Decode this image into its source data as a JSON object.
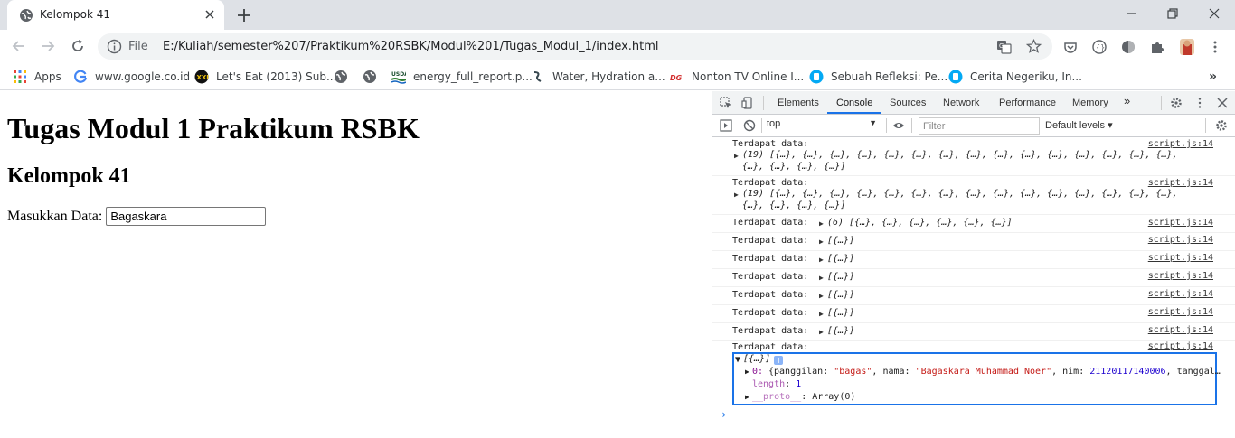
{
  "browser": {
    "tab_title": "Kelompok 41",
    "omnibox": {
      "security_label": "File",
      "url": "E:/Kuliah/semester%207/Praktikum%20RSBK/Modul%201/Tugas_Modul_1/index.html"
    },
    "bookmarks": [
      {
        "label": "Apps",
        "icon": "apps-grid-icon"
      },
      {
        "label": "www.google.co.id",
        "icon": "google-g-icon"
      },
      {
        "label": "Let's Eat (2013) Sub...",
        "icon": "movie-site-icon"
      },
      {
        "label": "",
        "icon": "globe-icon"
      },
      {
        "label": "",
        "icon": "globe-icon"
      },
      {
        "label": "energy_full_report.p...",
        "icon": "usda-icon"
      },
      {
        "label": "Water, Hydration a...",
        "icon": "water-site-icon"
      },
      {
        "label": "Nonton TV Online I...",
        "icon": "tv-site-icon"
      },
      {
        "label": "Sebuah Refleksi: Pe...",
        "icon": "blog-site-icon"
      },
      {
        "label": "Cerita Negeriku, In...",
        "icon": "blog-site-icon"
      }
    ]
  },
  "page": {
    "heading": "Tugas Modul 1 Praktikum RSBK",
    "subheading": "Kelompok 41",
    "input_label": "Masukkan Data:",
    "input_value": "Bagaskara"
  },
  "devtools": {
    "tabs": [
      "Elements",
      "Console",
      "Sources",
      "Network",
      "Performance",
      "Memory"
    ],
    "active_tab": "Console",
    "context": "top",
    "filter_placeholder": "Filter",
    "levels_label": "Default levels ▾",
    "source_link": "script.js:14",
    "messages": [
      {
        "text": "Terdapat data:",
        "obj": "(19) [{…}, {…}, {…}, {…}, {…}, {…}, {…}, {…}, {…}, {…}, {…}, {…}, {…}, {…}, {…},",
        "obj2": "{…}, {…}, {…}, {…}]"
      },
      {
        "text": "Terdapat data:",
        "obj": "(19) [{…}, {…}, {…}, {…}, {…}, {…}, {…}, {…}, {…}, {…}, {…}, {…}, {…}, {…}, {…},",
        "obj2": "{…}, {…}, {…}, {…}]"
      },
      {
        "text": "Terdapat data:",
        "obj": "(6) [{…}, {…}, {…}, {…}, {…}, {…}]"
      },
      {
        "text": "Terdapat data:",
        "obj": "[{…}]"
      },
      {
        "text": "Terdapat data:",
        "obj": "[{…}]"
      },
      {
        "text": "Terdapat data:",
        "obj": "[{…}]"
      },
      {
        "text": "Terdapat data:",
        "obj": "[{…}]"
      },
      {
        "text": "Terdapat data:",
        "obj": "[{…}]"
      },
      {
        "text": "Terdapat data:",
        "obj": "[{…}]"
      },
      {
        "text": "Terdapat data:",
        "obj": ""
      }
    ],
    "expanded": {
      "summary": "[{…}]",
      "item_index": "0:",
      "item_open": "{panggilan: ",
      "panggilan": "\"bagas\"",
      "nama_key": ", nama: ",
      "nama": "\"Bagaskara Muhammad Noer\"",
      "nim_key": ", nim: ",
      "nim": "21120117140006",
      "tail": ", tanggal…",
      "length_key": "length",
      "length_value": "1",
      "proto_key": "__proto__",
      "proto_value": ": Array(0)"
    },
    "prompt": "›"
  }
}
